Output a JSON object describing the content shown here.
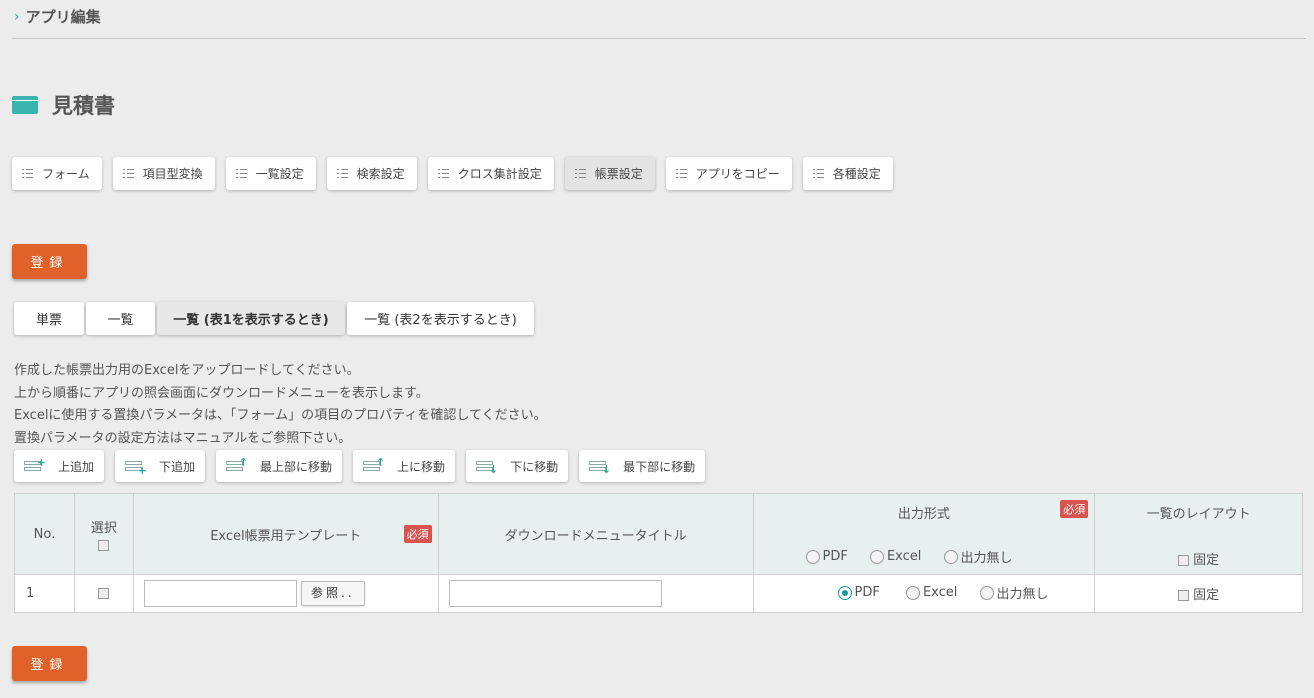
{
  "breadcrumb": {
    "label": "アプリ編集"
  },
  "page": {
    "title": "見積書"
  },
  "toolbar": [
    {
      "label": "フォーム"
    },
    {
      "label": "項目型変換"
    },
    {
      "label": "一覧設定"
    },
    {
      "label": "検索設定"
    },
    {
      "label": "クロス集計設定"
    },
    {
      "label": "帳票設定"
    },
    {
      "label": "アプリをコピー"
    },
    {
      "label": "各種設定"
    }
  ],
  "register_label": "登録",
  "tabs": [
    {
      "label": "単票"
    },
    {
      "label": "一覧"
    },
    {
      "label": "一覧 (表1を表示するとき)"
    },
    {
      "label": "一覧 (表2を表示するとき)"
    }
  ],
  "description": [
    "作成した帳票出力用のExcelをアップロードしてください。",
    "上から順番にアプリの照会画面にダウンロードメニューを表示します。",
    "Excelに使用する置換パラメータは、「フォーム」の項目のプロパティを確認してください。",
    "置換パラメータの設定方法はマニュアルをご参照下さい。"
  ],
  "row_buttons": [
    {
      "label": "上追加"
    },
    {
      "label": "下追加"
    },
    {
      "label": "最上部に移動"
    },
    {
      "label": "上に移動"
    },
    {
      "label": "下に移動"
    },
    {
      "label": "最下部に移動"
    }
  ],
  "table": {
    "headers": {
      "no": "No.",
      "select": "選択",
      "template": "Excel帳票用テンプレート",
      "menu_title": "ダウンロードメニュータイトル",
      "output_format": "出力形式",
      "layout": "一覧のレイアウト"
    },
    "required_badge": "必須",
    "format_options": [
      "PDF",
      "Excel",
      "出力無し"
    ],
    "fixed_label": "固定",
    "browse_label": "参照..",
    "rows": [
      {
        "no": "1",
        "selected_format": "PDF"
      }
    ]
  }
}
